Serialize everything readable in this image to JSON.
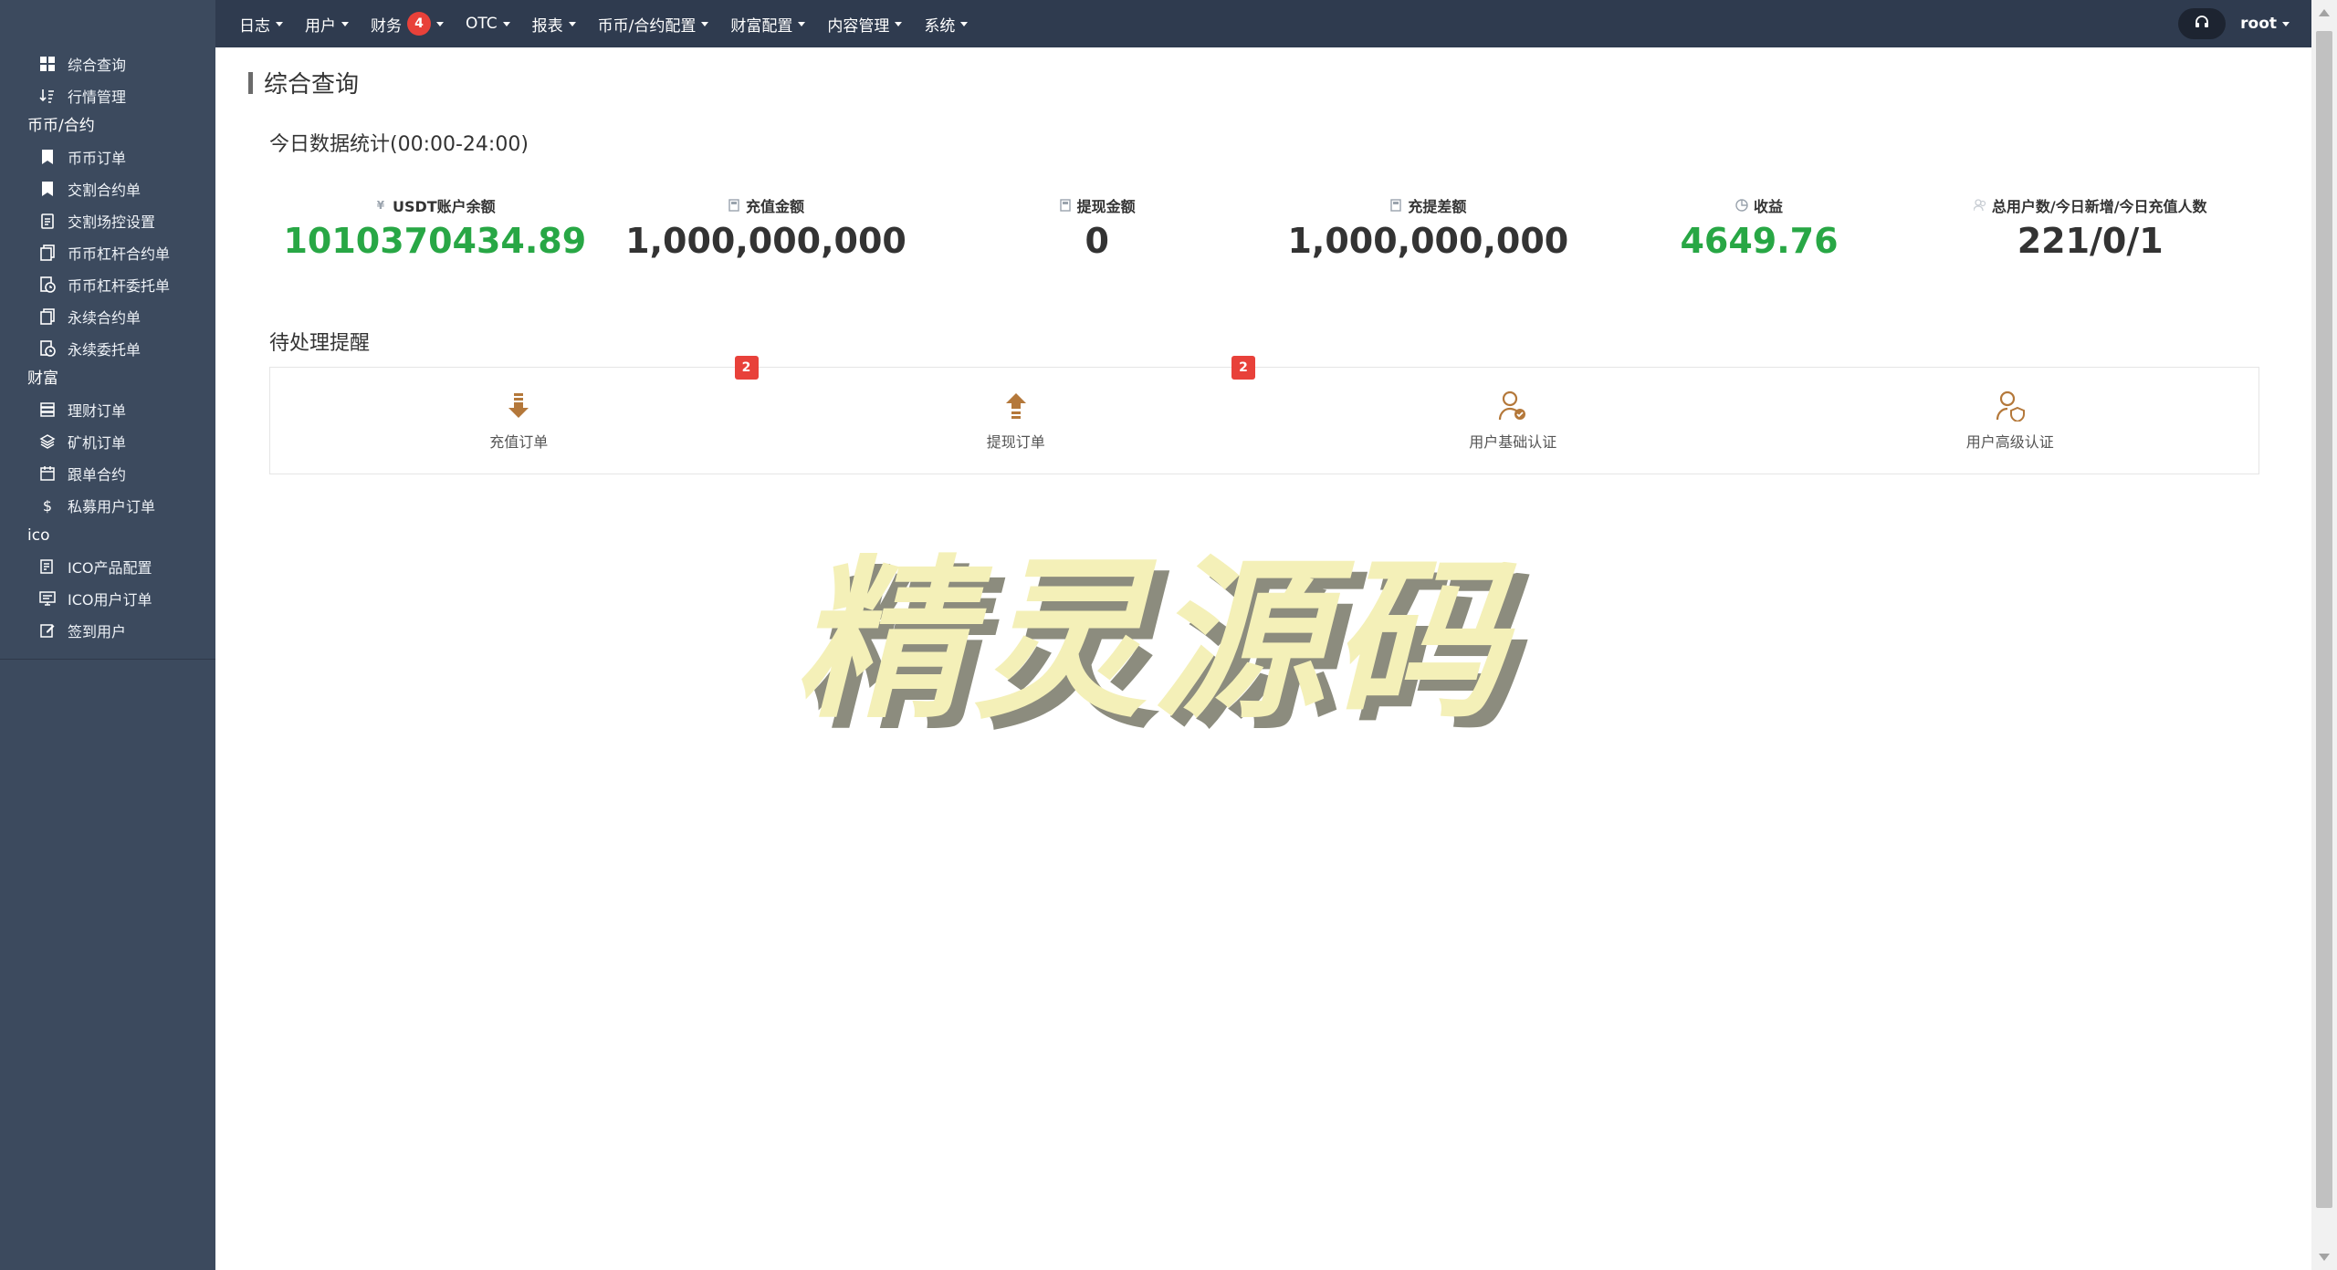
{
  "topnav": {
    "items": [
      {
        "label": "日志"
      },
      {
        "label": "用户"
      },
      {
        "label": "财务",
        "badge": "4"
      },
      {
        "label": "OTC"
      },
      {
        "label": "报表"
      },
      {
        "label": "币币/合约配置"
      },
      {
        "label": "财富配置"
      },
      {
        "label": "内容管理"
      },
      {
        "label": "系统"
      }
    ],
    "user": "root"
  },
  "sidebar": {
    "top_items": [
      {
        "label": "综合查询",
        "icon": "dashboard-icon"
      },
      {
        "label": "行情管理",
        "icon": "sort-icon"
      }
    ],
    "sections": [
      {
        "title": "币币/合约",
        "items": [
          {
            "label": "币币订单",
            "icon": "bookmark-icon"
          },
          {
            "label": "交割合约单",
            "icon": "bookmark-icon"
          },
          {
            "label": "交割场控设置",
            "icon": "clipboard-icon"
          },
          {
            "label": "币币杠杆合约单",
            "icon": "copy-icon"
          },
          {
            "label": "币币杠杆委托单",
            "icon": "clock-file-icon"
          },
          {
            "label": "永续合约单",
            "icon": "copy-icon"
          },
          {
            "label": "永续委托单",
            "icon": "clock-file-icon"
          }
        ]
      },
      {
        "title": "财富",
        "items": [
          {
            "label": "理财订单",
            "icon": "database-icon"
          },
          {
            "label": "矿机订单",
            "icon": "layers-icon"
          },
          {
            "label": "跟单合约",
            "icon": "calendar-icon"
          },
          {
            "label": "私募用户订单",
            "icon": "dollar-icon"
          }
        ]
      },
      {
        "title": "ico",
        "items": [
          {
            "label": "ICO产品配置",
            "icon": "file-edit-icon"
          },
          {
            "label": "ICO用户订单",
            "icon": "monitor-icon"
          },
          {
            "label": "签到用户",
            "icon": "edit-icon"
          }
        ]
      }
    ]
  },
  "page": {
    "title": "综合查询",
    "stats_title": "今日数据统计(00:00-24:00)",
    "stats": [
      {
        "label": "USDT账户余额",
        "value": "1010370434.89",
        "color": "#28a745",
        "icon": "yen-icon"
      },
      {
        "label": "充值金额",
        "value": "1,000,000,000",
        "color": "#333333",
        "icon": "calculator-icon"
      },
      {
        "label": "提现金额",
        "value": "0",
        "color": "#333333",
        "icon": "calculator-icon"
      },
      {
        "label": "充提差额",
        "value": "1,000,000,000",
        "color": "#333333",
        "icon": "calculator-icon"
      },
      {
        "label": "收益",
        "value": "4649.76",
        "color": "#28a745",
        "icon": "pie-chart-icon"
      },
      {
        "label": "总用户数/今日新增/今日充值人数",
        "value": "221/0/1",
        "color": "#333333",
        "icon": "users-icon"
      }
    ],
    "pending_title": "待处理提醒",
    "pending": [
      {
        "label": "充值订单",
        "badge": "2",
        "icon": "arrow-down-icon"
      },
      {
        "label": "提现订单",
        "badge": "2",
        "icon": "arrow-up-icon"
      },
      {
        "label": "用户基础认证",
        "badge": "",
        "icon": "user-check-icon"
      },
      {
        "label": "用户高级认证",
        "badge": "",
        "icon": "user-shield-icon"
      }
    ],
    "watermark": "精灵源码"
  },
  "colors": {
    "sidebar_bg": "#3c4a5e",
    "topbar_bg": "#2f3b4f",
    "accent_green": "#28a745",
    "badge_red": "#e8413a",
    "pending_icon": "#b4783a"
  }
}
